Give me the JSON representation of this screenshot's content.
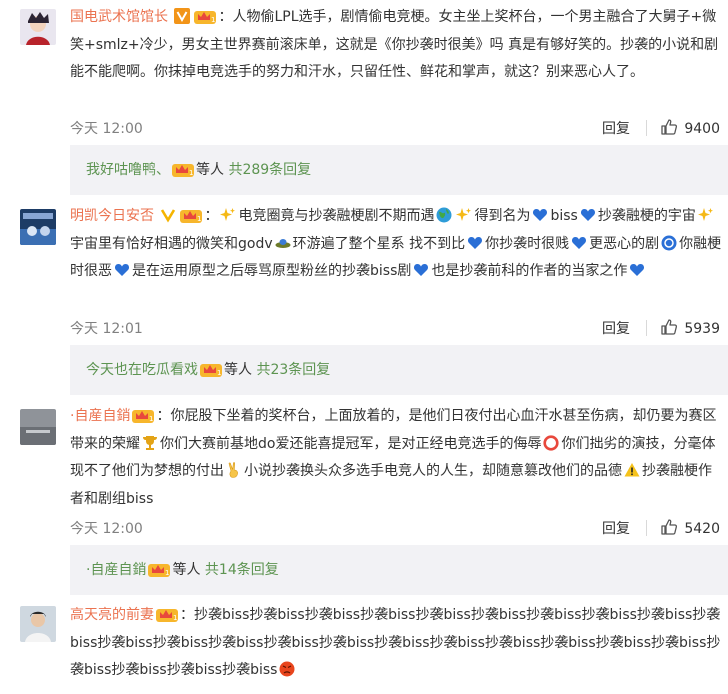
{
  "comments": [
    {
      "username": "国电武术馆馆长",
      "text_1": "：人物偷LPL选手，剧情偷电竞梗。女主坐上奖杯台，一个男主融合了大舅子+微笑+smlz+冷少，男女主世界赛前滚床单，这就是《你抄袭时很美》吗 真是有够好笑的。抄袭的小说和剧能不能爬啊。你抹掉电竞选手的努力和汗水，只留任性、鲜花和掌声，就这？别来恶心人了。",
      "time": "今天 12:00",
      "reply_label": "回复",
      "likes": "9400",
      "sub_first": "我好咕噜鸭、",
      "sub_mid": "等人",
      "sub_count": "共289条回复"
    },
    {
      "username": "明凯今日安否",
      "seg_1": "：",
      "seg_2": "电竞圈竟与抄袭融梗剧不期而遇",
      "seg_3": "得到名为",
      "seg_4": "biss",
      "seg_5": "抄袭融梗的宇宙",
      "seg_6": "宇宙里有恰好相遇的微笑和godv",
      "seg_7": "环游遍了整个星系 找不到比",
      "seg_8": "你抄袭时很贱",
      "seg_9": "更恶心的剧",
      "seg_10": "你融梗时很恶",
      "seg_11": "是在运用原型之后辱骂原型粉丝的抄袭biss剧",
      "seg_12": "也是抄袭前科的作者的当家之作",
      "time": "今天 12:01",
      "reply_label": "回复",
      "likes": "5939",
      "sub_first": "今天也在吃瓜看戏",
      "sub_mid": "等人",
      "sub_count": "共23条回复"
    },
    {
      "username": "·自産自銷",
      "seg_1": "：你屁股下坐着的奖杯台，上面放着的，是他们日夜付出心血汗水甚至伤病，却仍要为赛区带来的荣耀",
      "seg_2": "你们大赛前基地do爱还能喜提冠军，是对正经电竞选手的侮辱",
      "seg_3": "你们拙劣的演技，分毫体现不了他们为梦想的付出",
      "seg_4": "小说抄袭换头众多选手电竞人的人生，却随意篡改他们的品德",
      "seg_5": "抄袭融梗作者和剧组biss",
      "time": "今天 12:00",
      "reply_label": "回复",
      "likes": "5420",
      "sub_first": "·自産自銷",
      "sub_mid": "等人",
      "sub_count": "共14条回复"
    },
    {
      "username": "高天亮的前妻",
      "text_1": "：抄袭biss抄袭biss抄袭biss抄袭biss抄袭biss抄袭biss抄袭biss抄袭biss抄袭biss抄袭biss抄袭biss抄袭biss抄袭biss抄袭biss抄袭biss抄袭biss抄袭biss抄袭biss抄袭biss抄袭biss抄袭biss抄袭biss抄袭biss抄袭biss抄袭biss"
    }
  ],
  "colors": {
    "username": "#eb7350",
    "link": "#5d9451",
    "subbox_bg": "#f2f2f5",
    "heart": "#2a6fd6"
  },
  "icons": [
    "avatar",
    "vip-badge",
    "crown-badge",
    "like-icon",
    "sparkle-icon",
    "globe-icon",
    "heart-icon",
    "trophy-icon",
    "stop-icon",
    "victory-hand-icon",
    "warning-icon",
    "angry-face-icon"
  ]
}
